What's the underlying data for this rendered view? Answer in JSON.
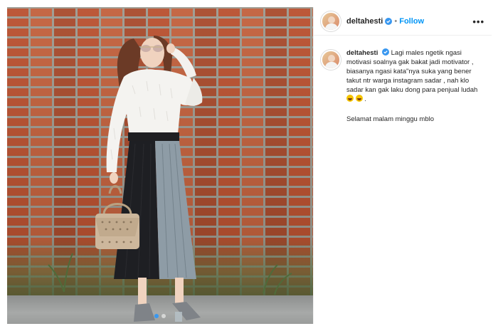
{
  "post": {
    "username": "deltahesti",
    "separator": "•",
    "follow_label": "Follow",
    "more_label": "•••",
    "caption_text": "Lagi males ngetik ngasi motivasi soalnya gak bakat jadi motivator , biasanya ngasi kata\"nya suka yang bener takut ntr warga instagram sadar , nah klo sadar kan gak laku dong para penjual ludah",
    "caption_end": ".",
    "caption_line2": "Selamat malam minggu mblo",
    "carousel": {
      "count": 2,
      "active_index": 0
    }
  },
  "icons": {
    "verified": "verified-badge-icon",
    "emoji": "laughing-emoji-icon",
    "more": "more-options-icon"
  },
  "colors": {
    "follow": "#0095f6",
    "verified": "#3897f0",
    "text": "#262626",
    "border": "#efefef"
  }
}
